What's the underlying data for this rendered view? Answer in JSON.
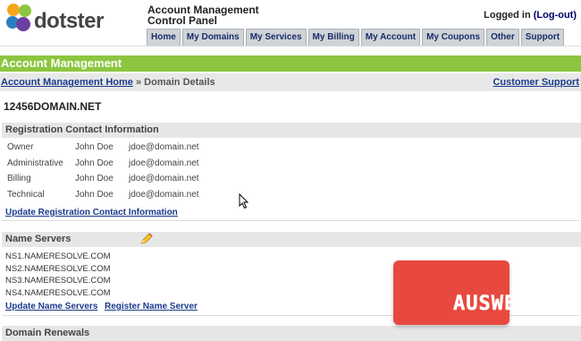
{
  "header": {
    "brand": "dotster",
    "panel_title_line1": "Account Management",
    "panel_title_line2": "Control Panel",
    "login_text": "Logged in",
    "logout_label": "(Log-out)",
    "tabs": [
      {
        "label": "Home"
      },
      {
        "label": "My Domains"
      },
      {
        "label": "My Services"
      },
      {
        "label": "My Billing"
      },
      {
        "label": "My Account"
      },
      {
        "label": "My Coupons"
      },
      {
        "label": "Other"
      },
      {
        "label": "Support"
      }
    ]
  },
  "banner": {
    "title": "Account Management"
  },
  "breadcrumb": {
    "home_link": "Account Management Home",
    "separator": "»",
    "current": "Domain Details",
    "support_link": "Customer Support"
  },
  "domain": {
    "name": "12456DOMAIN.NET"
  },
  "registration": {
    "heading": "Registration Contact Information",
    "contacts": [
      {
        "role": "Owner",
        "name": "John Doe",
        "email": "jdoe@domain.net"
      },
      {
        "role": "Administrative",
        "name": "John Doe",
        "email": "jdoe@domain.net"
      },
      {
        "role": "Billing",
        "name": "John Doe",
        "email": "jdoe@domain.net"
      },
      {
        "role": "Technical",
        "name": "John Doe",
        "email": "jdoe@domain.net"
      }
    ],
    "update_link": "Update Registration Contact Information"
  },
  "nameservers": {
    "heading": "Name Servers",
    "servers": [
      "NS1.NAMERESOLVE.COM",
      "NS2.NAMERESOLVE.COM",
      "NS3.NAMERESOLVE.COM",
      "NS4.NAMERESOLVE.COM"
    ],
    "update_link": "Update Name Servers",
    "register_link": "Register Name Server"
  },
  "renewals": {
    "heading": "Domain Renewals"
  },
  "watermark": {
    "text": "AUSWEB"
  },
  "colors": {
    "banner": "#8cc63f",
    "link": "#1a3a8c",
    "tab_bg": "#cfd3d6",
    "watermark": "#e8493f"
  }
}
